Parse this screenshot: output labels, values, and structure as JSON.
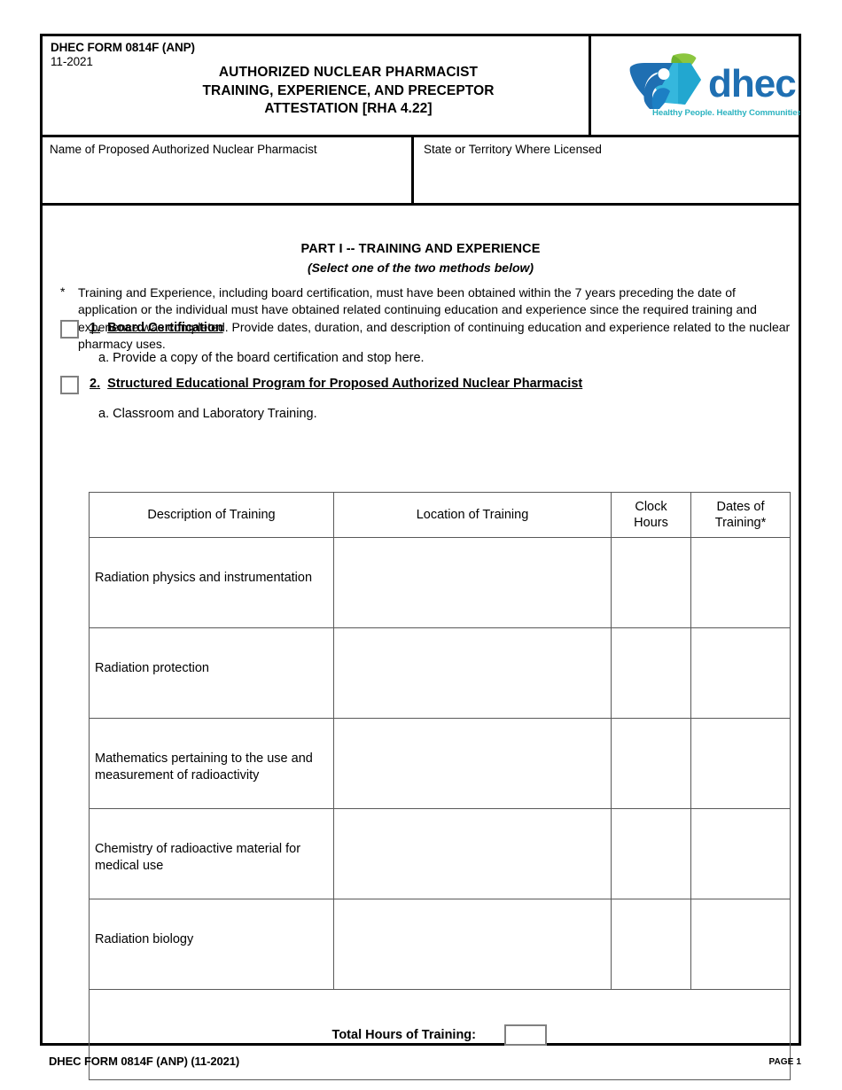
{
  "header": {
    "form_id": "DHEC FORM 0814F (ANP)",
    "form_date": "11-2021",
    "title_line1": "AUTHORIZED NUCLEAR PHARMACIST",
    "title_line2": "TRAINING, EXPERIENCE, AND PRECEPTOR",
    "title_line3": "ATTESTATION [RHA 4.22]",
    "logo": {
      "wordmark": "dhec",
      "tagline": "Healthy People. Healthy Communities.",
      "colors": {
        "dark_blue": "#1f6fb2",
        "mid_blue": "#1c7fc4",
        "cyan": "#35b7dd",
        "teal": "#2bb3c0",
        "leaf_green": "#8cc63f",
        "leaf_green_dark": "#5fa82b"
      }
    }
  },
  "fields": {
    "name_label": "Name of Proposed Authorized Nuclear Pharmacist",
    "name_value": "",
    "state_label": "State or Territory Where Licensed",
    "state_value": ""
  },
  "part": {
    "title": "PART I -- TRAINING AND EXPERIENCE",
    "subtitle": "(Select one of the two methods below)",
    "note_marker": "*",
    "note": "Training and Experience, including board certification, must have been obtained within the 7 years preceding the date of application or the individual must have obtained related continuing education and experience since the required training and experience was completed. Provide dates, duration, and description of continuing education and experience related to the nuclear pharmacy uses."
  },
  "options": [
    {
      "number": "1.",
      "heading": "Board Certification",
      "checked": false,
      "sub": "a. Provide a copy of the board certification and stop here."
    },
    {
      "number": "2.",
      "heading": "Structured Educational Program for Proposed Authorized Nuclear Pharmacist",
      "checked": false,
      "sub": "a.  Classroom and Laboratory Training."
    }
  ],
  "table": {
    "columns": [
      "Description of Training",
      "Location of Training",
      "Clock\nHours",
      "Dates of\nTraining*"
    ],
    "columns_display": {
      "desc": "Description of Training",
      "loc": "Location of Training",
      "hours_l1": "Clock",
      "hours_l2": "Hours",
      "dates_l1": "Dates of",
      "dates_l2": "Training*"
    },
    "rows": [
      {
        "description": "Radiation physics and instrumentation",
        "location": "",
        "clock_hours": "",
        "dates": ""
      },
      {
        "description": "Radiation protection",
        "location": "",
        "clock_hours": "",
        "dates": ""
      },
      {
        "description": "Mathematics pertaining to the use and measurement of radioactivity",
        "location": "",
        "clock_hours": "",
        "dates": ""
      },
      {
        "description": "Chemistry of radioactive material for medical use",
        "location": "",
        "clock_hours": "",
        "dates": ""
      },
      {
        "description": "Radiation biology",
        "location": "",
        "clock_hours": "",
        "dates": ""
      }
    ],
    "total_label": "Total Hours of Training:",
    "total_value": ""
  },
  "footer": {
    "left": "DHEC FORM 0814F (ANP)  (11-2021)",
    "right": "PAGE 1"
  }
}
